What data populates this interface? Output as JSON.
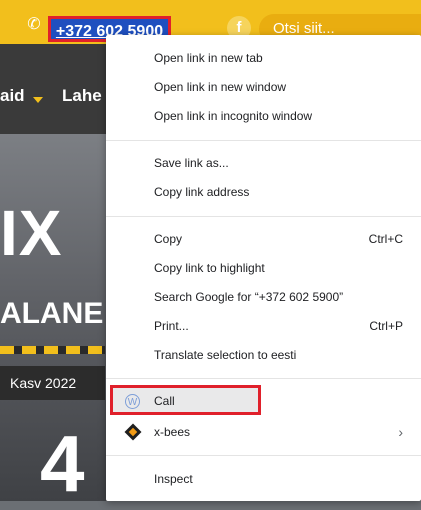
{
  "header": {
    "phone_label": "+372 602 5900",
    "facebook_glyph": "f",
    "search_placeholder": "Otsi siit..."
  },
  "nav": {
    "items": [
      "aid",
      "Lahe"
    ]
  },
  "hero": {
    "big_text": "IX",
    "sub_text": "ALANE",
    "strip_text": "Kasv 2022",
    "number_text": "4"
  },
  "menu": {
    "items": [
      {
        "label": "Open link in new tab"
      },
      {
        "label": "Open link in new window"
      },
      {
        "label": "Open link in incognito window"
      },
      {
        "label": "Save link as..."
      },
      {
        "label": "Copy link address"
      },
      {
        "label": "Copy",
        "shortcut": "Ctrl+C"
      },
      {
        "label": "Copy link to highlight"
      },
      {
        "label": "Search Google for “+372 602 5900”"
      },
      {
        "label": "Print...",
        "shortcut": "Ctrl+P"
      },
      {
        "label": "Translate selection to eesti"
      },
      {
        "label": "Call"
      },
      {
        "label": "x-bees"
      },
      {
        "label": "Inspect"
      }
    ]
  },
  "colors": {
    "brand_yellow": "#f2bf1c",
    "highlight_red": "#e0202b",
    "link_blue": "#1f4fbf"
  }
}
